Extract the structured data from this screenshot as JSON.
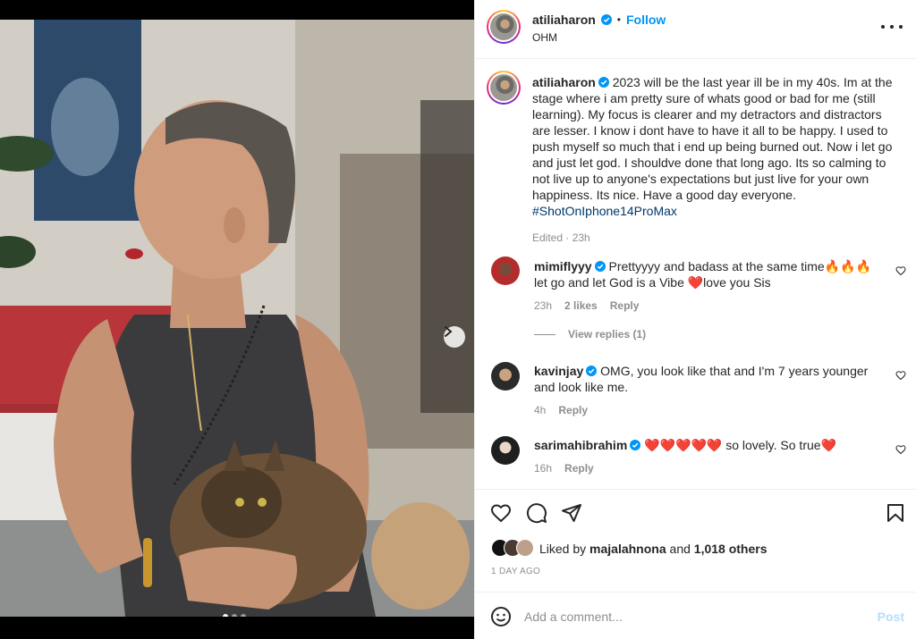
{
  "post": {
    "author": "atiliaharon",
    "verified": true,
    "follow_label": "Follow",
    "separator": "•",
    "location": "OHM"
  },
  "caption": {
    "username": "atiliaharon",
    "text": "2023 will be the last year ill be in my 40s. Im at the stage where i am pretty sure of whats good or bad for me (still learning). My focus is clearer and my detractors and distractors are lesser. I know i dont have to have it all to be happy. I used to push myself so much that i end up being burned out. Now i let go and just let god. I shouldve done that long ago. Its so calming to not live up to anyone's expectations but just live for your own happiness. Its nice. Have a good day everyone.",
    "hashtag": "#ShotOnIphone14ProMax",
    "meta": "Edited · 23h"
  },
  "comments": [
    {
      "username": "mimiflyyy",
      "text": "Prettyyyy and badass at the same time🔥🔥🔥 let go and let God is a Vibe ❤️love you Sis",
      "time": "23h",
      "likes": "2 likes",
      "reply": "Reply",
      "view_replies": "View replies (1)"
    },
    {
      "username": "kavinjay",
      "text": "OMG, you look like that and I'm 7 years younger and look like me.",
      "time": "4h",
      "reply": "Reply"
    },
    {
      "username": "sarimahibrahim",
      "text": "❤️❤️❤️❤️❤️ so lovely. So true❤️",
      "time": "16h",
      "reply": "Reply"
    }
  ],
  "likes": {
    "prefix": "Liked by",
    "user": "majalahnona",
    "and": "and",
    "others": "1,018 others"
  },
  "date": "1 DAY AGO",
  "composer": {
    "placeholder": "Add a comment...",
    "post_label": "Post"
  },
  "icons": {
    "more": "more-icon",
    "like": "heart-icon",
    "comment": "comment-icon",
    "share": "share-icon",
    "save": "bookmark-icon",
    "emoji": "emoji-icon",
    "next": "chevron-right-icon"
  },
  "colors": {
    "accent": "#0095f6",
    "verified": "#0095f6",
    "hashtag": "#00376b",
    "muted": "#8e8e8e",
    "post_disabled": "#b2dffc"
  },
  "carousel": {
    "slides": 3,
    "current": 1
  }
}
